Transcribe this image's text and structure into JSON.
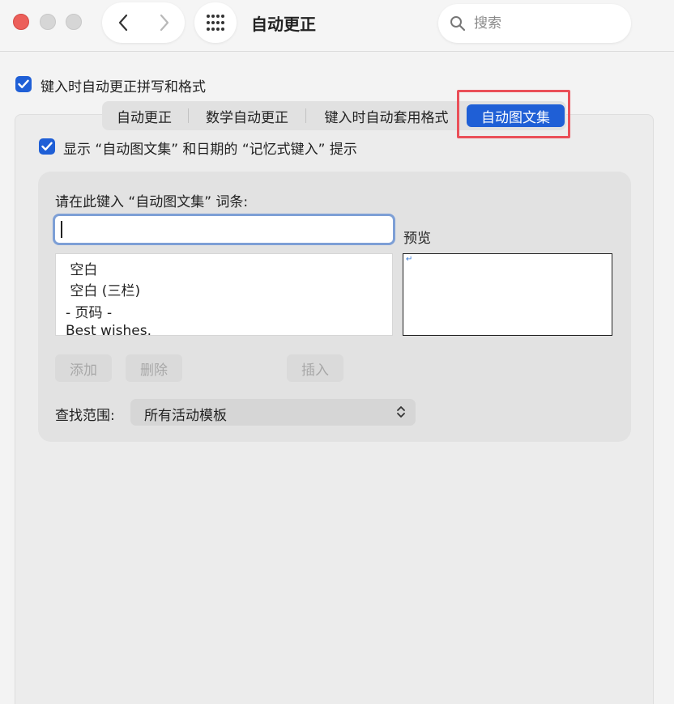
{
  "window": {
    "title": "自动更正",
    "search_placeholder": "搜索"
  },
  "top_checkbox": {
    "label": "键入时自动更正拼写和格式",
    "checked": true
  },
  "tabs": [
    {
      "label": "自动更正",
      "active": false
    },
    {
      "label": "数学自动更正",
      "active": false
    },
    {
      "label": "键入时自动套用格式",
      "active": false
    },
    {
      "label": "自动图文集",
      "active": true
    }
  ],
  "show_checkbox": {
    "label": "显示 “自动图文集” 和日期的 “记忆式键入” 提示",
    "checked": true
  },
  "autotext": {
    "prompt": "请在此键入 “自动图文集” 词条:",
    "entry_value": "",
    "preview_label": "预览",
    "preview_mark": "↵",
    "items": [
      " 空白",
      " 空白 (三栏)",
      "- 页码 -",
      "Best wishes."
    ],
    "buttons": {
      "add": "添加",
      "delete": "删除",
      "insert": "插入"
    },
    "scope_label": "查找范围:",
    "scope_value": "所有活动模板"
  },
  "colors": {
    "accent": "#1f5fd6",
    "highlight": "#ea4f58",
    "close": "#ec5f5a"
  }
}
